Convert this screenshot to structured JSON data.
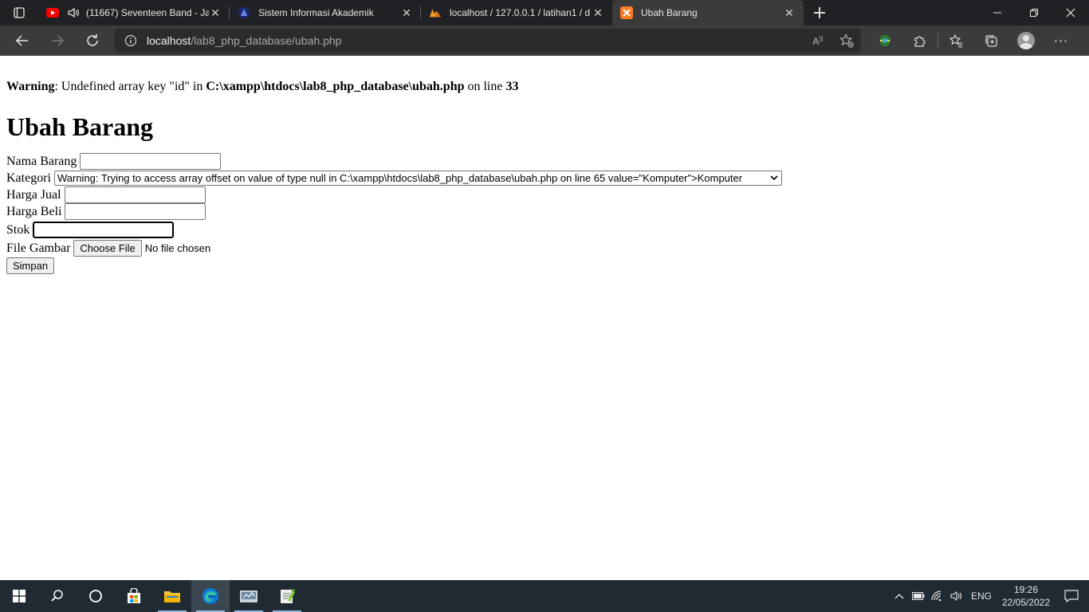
{
  "browser": {
    "tabs": [
      {
        "title": "(11667) Seventeen Band - Ja",
        "icon": "youtube-icon",
        "has_audio": true
      },
      {
        "title": "Sistem Informasi Akademik",
        "icon": "university-icon"
      },
      {
        "title": "localhost / 127.0.0.1 / latihan1 / d",
        "icon": "phpmyadmin-icon"
      },
      {
        "title": "Ubah Barang",
        "icon": "xampp-icon",
        "active": true
      }
    ],
    "address": {
      "host": "localhost",
      "path": "/lab8_php_database/ubah.php"
    },
    "colors": {
      "tab_strip": "#202124",
      "toolbar": "#3b3b3b",
      "youtube_red": "#ff0000",
      "xampp_orange": "#fb7a24"
    }
  },
  "page": {
    "warning": {
      "label": "Warning",
      "text_1": ": Undefined array key \"id\" in ",
      "file": "C:\\xampp\\htdocs\\lab8_php_database\\ubah.php",
      "text_2": " on line ",
      "line": "33"
    },
    "heading": "Ubah Barang",
    "form": {
      "nama_label": "Nama Barang",
      "nama_value": "",
      "kategori_label": "Kategori",
      "kategori_selected": "Warning: Trying to access array offset on value of type null in C:\\xampp\\htdocs\\lab8_php_database\\ubah.php on line 65 value=\"Komputer\">Komputer",
      "harga_jual_label": "Harga Jual",
      "harga_jual_value": "",
      "harga_beli_label": "Harga Beli",
      "harga_beli_value": "",
      "stok_label": "Stok",
      "stok_value": "",
      "file_label": "File Gambar",
      "file_button": "Choose File",
      "file_status": "No file chosen",
      "submit_label": "Simpan"
    }
  },
  "taskbar": {
    "language": "ENG",
    "time": "19:26",
    "date": "22/05/2022",
    "background": "#1f2a33"
  }
}
